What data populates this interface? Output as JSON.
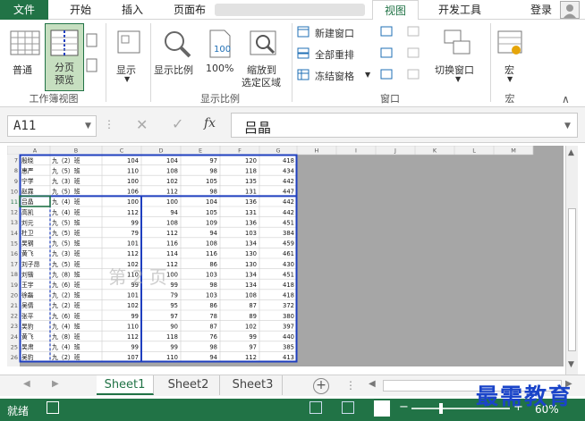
{
  "tabs": {
    "file": "文件",
    "home": "开始",
    "insert": "插入",
    "layout": "页面布",
    "view": "视图",
    "developer": "开发工具",
    "login": "登录"
  },
  "ribbon": {
    "normal": "普通",
    "page_break": "分页\n预览",
    "page_break_l1": "分页",
    "page_break_l2": "预览",
    "show": "显示",
    "zoom": "显示比例",
    "zoom100": "100%",
    "zoom_sel_l1": "缩放到",
    "zoom_sel_l2": "选定区域",
    "new_window": "新建窗口",
    "arrange_all": "全部重排",
    "freeze": "冻结窗格",
    "switch_window": "切换窗口",
    "macro": "宏",
    "group_workbook_view": "工作簿视图",
    "group_zoom": "显示比例",
    "group_window": "窗口",
    "group_macro": "宏"
  },
  "formula_bar": {
    "name_box": "A11",
    "content": "吕晶",
    "fx": "fx"
  },
  "sheet": {
    "col_headers": [
      "A",
      "B",
      "C",
      "D",
      "E",
      "F",
      "G",
      "H",
      "I",
      "J",
      "K",
      "L",
      "M"
    ],
    "row_numbers": [
      "7",
      "8",
      "9",
      "10",
      "11",
      "12",
      "13",
      "14",
      "15",
      "16",
      "17",
      "18",
      "19",
      "20",
      "21",
      "22",
      "23",
      "24",
      "25",
      "26"
    ],
    "rows": [
      [
        "殷晓",
        "九（2）班",
        "104",
        "104",
        "97",
        "120",
        "418"
      ],
      [
        "惠严",
        "九（5）班",
        "110",
        "108",
        "98",
        "118",
        "434"
      ],
      [
        "宁学",
        "九（3）班",
        "100",
        "102",
        "105",
        "135",
        "442"
      ],
      [
        "赵霖",
        "九（5）班",
        "106",
        "112",
        "98",
        "131",
        "447"
      ],
      [
        "吕晶",
        "九（4）班",
        "100",
        "100",
        "104",
        "136",
        "442"
      ],
      [
        "高凯",
        "九（4）班",
        "112",
        "94",
        "105",
        "131",
        "442"
      ],
      [
        "刘元",
        "九（5）班",
        "99",
        "108",
        "109",
        "136",
        "451"
      ],
      [
        "杜卫",
        "九（5）班",
        "79",
        "112",
        "94",
        "103",
        "384"
      ],
      [
        "吴钢",
        "九（5）班",
        "101",
        "116",
        "108",
        "134",
        "459"
      ],
      [
        "黄飞",
        "九（3）班",
        "112",
        "114",
        "116",
        "130",
        "461"
      ],
      [
        "刘子昂",
        "九（5）班",
        "102",
        "112",
        "86",
        "130",
        "430"
      ],
      [
        "刘锴",
        "九（8）班",
        "110",
        "100",
        "103",
        "134",
        "451"
      ],
      [
        "王宇",
        "九（6）班",
        "99",
        "99",
        "98",
        "134",
        "418"
      ],
      [
        "徐磊",
        "九（2）班",
        "101",
        "79",
        "103",
        "108",
        "418"
      ],
      [
        "吴倩",
        "九（2）班",
        "102",
        "95",
        "86",
        "87",
        "372"
      ],
      [
        "张平",
        "九（6）班",
        "99",
        "97",
        "78",
        "89",
        "380"
      ],
      [
        "吴豹",
        "九（4）班",
        "110",
        "90",
        "87",
        "102",
        "397"
      ],
      [
        "黄飞",
        "九（8）班",
        "112",
        "118",
        "76",
        "99",
        "440"
      ],
      [
        "吴肃",
        "九（4）班",
        "99",
        "99",
        "98",
        "97",
        "385"
      ],
      [
        "吴豹",
        "九（2）班",
        "107",
        "110",
        "94",
        "112",
        "413"
      ]
    ],
    "page_watermark": "第 2 页"
  },
  "sheet_tabs": [
    "Sheet1",
    "Sheet2",
    "Sheet3"
  ],
  "status": {
    "ready": "就绪",
    "zoom": "60%"
  },
  "watermark": "最需教育",
  "colors": {
    "excel_green": "#217346",
    "page_border": "#1f3fbf"
  }
}
